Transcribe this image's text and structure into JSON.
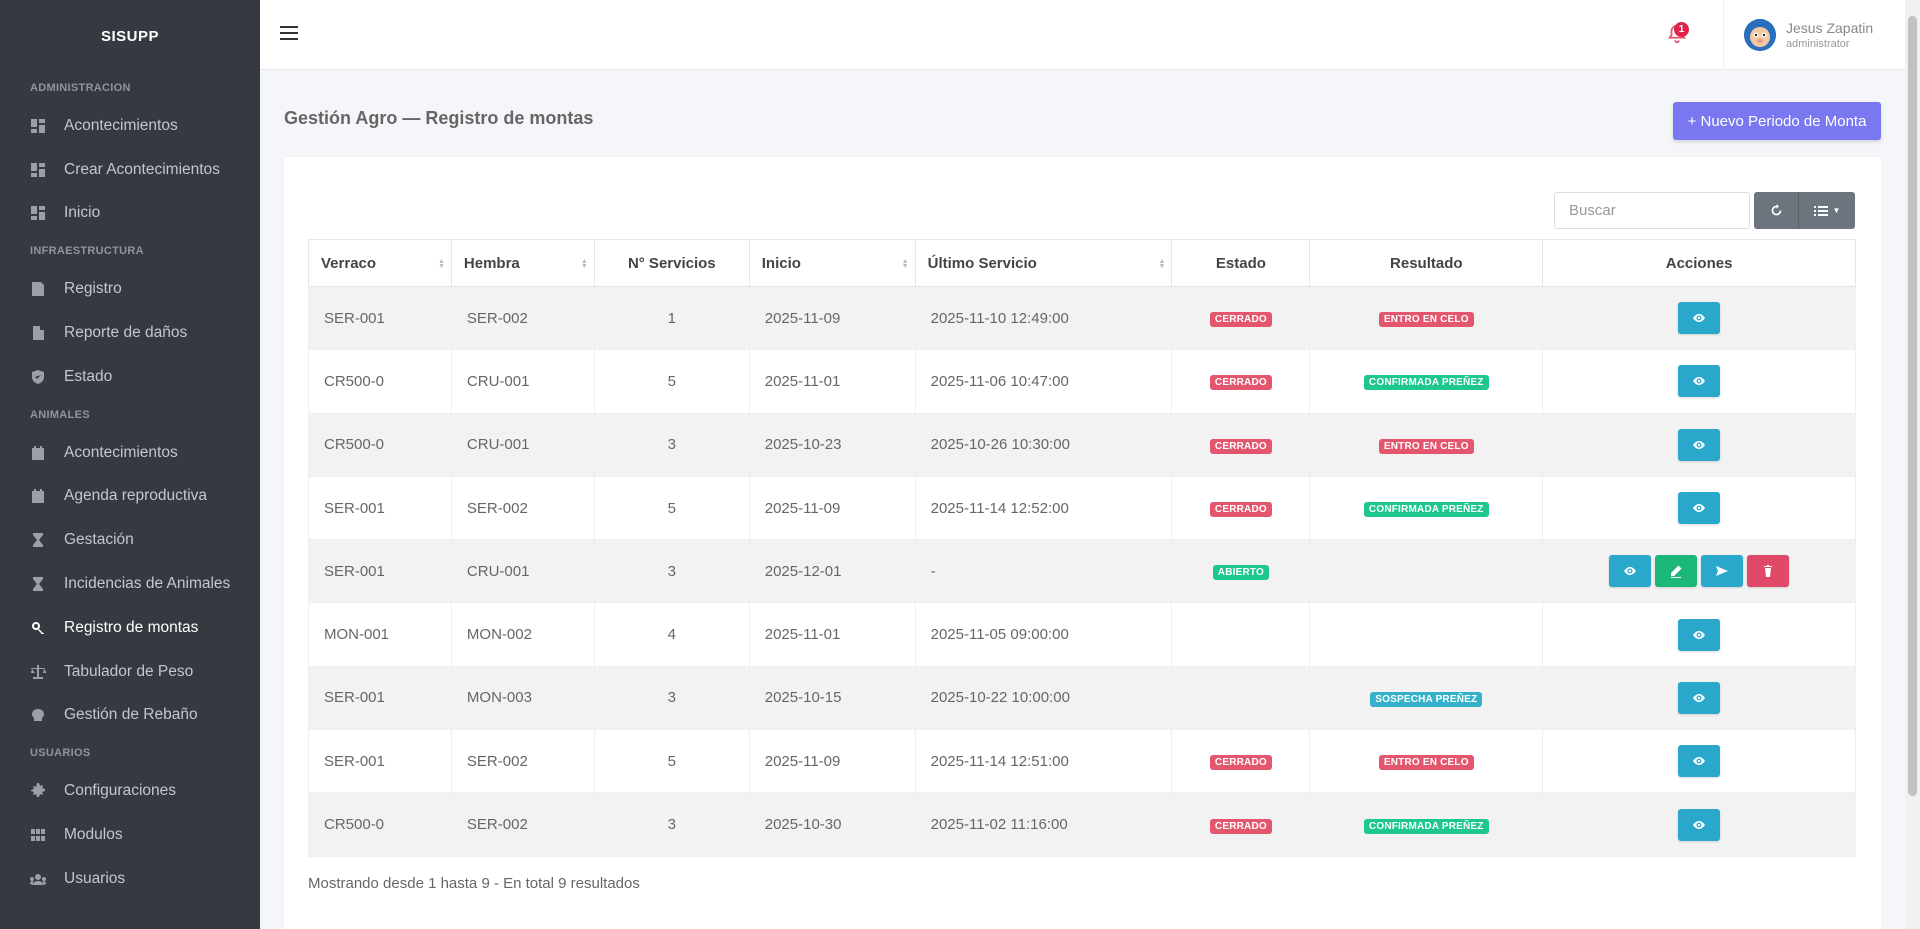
{
  "brand": "SISUPP",
  "sidebar": {
    "sections": [
      {
        "title": "ADMINISTRACION",
        "items": [
          {
            "label": "Acontecimientos",
            "icon": "dashboard-icon"
          },
          {
            "label": "Crear Acontecimientos",
            "icon": "dashboard-icon"
          },
          {
            "label": "Inicio",
            "icon": "dashboard-icon"
          }
        ]
      },
      {
        "title": "INFRAESTRUCTURA",
        "items": [
          {
            "label": "Registro",
            "icon": "report-icon"
          },
          {
            "label": "Reporte de daños",
            "icon": "file-icon"
          },
          {
            "label": "Estado",
            "icon": "shield-icon"
          }
        ]
      },
      {
        "title": "ANIMALES",
        "items": [
          {
            "label": "Acontecimientos",
            "icon": "calendar-icon"
          },
          {
            "label": "Agenda reproductiva",
            "icon": "calendar-icon"
          },
          {
            "label": "Gestación",
            "icon": "hourglass-icon"
          },
          {
            "label": "Incidencias de Animales",
            "icon": "hourglass-icon"
          },
          {
            "label": "Registro de montas",
            "icon": "gender-icon",
            "active": true
          },
          {
            "label": "Tabulador de Peso",
            "icon": "scale-icon"
          },
          {
            "label": "Gestión de Rebaño",
            "icon": "herd-icon"
          }
        ]
      },
      {
        "title": "USUARIOS",
        "items": [
          {
            "label": "Configuraciones",
            "icon": "gear-icon"
          },
          {
            "label": "Modulos",
            "icon": "grid-icon"
          },
          {
            "label": "Usuarios",
            "icon": "users-icon"
          }
        ]
      }
    ]
  },
  "header": {
    "notification_count": "1",
    "user_name": "Jesus Zapatin",
    "user_role": "administrator"
  },
  "page": {
    "title": "Gestión Agro — Registro de montas",
    "new_button": "+  Nuevo Periodo de Monta"
  },
  "table": {
    "search_placeholder": "Buscar",
    "columns": [
      "Verraco",
      "Hembra",
      "N° Servicios",
      "Inicio",
      "Último Servicio",
      "Estado",
      "Resultado",
      "Acciones"
    ],
    "rows": [
      {
        "verraco": "SER-001",
        "hembra": "SER-002",
        "servicios": "1",
        "inicio": "2025-11-09",
        "ultimo": "2025-11-10 12:49:00",
        "estado": "CERRADO",
        "resultado": "ENTRO EN CELO",
        "actions": "view"
      },
      {
        "verraco": "CR500-0",
        "hembra": "CRU-001",
        "servicios": "5",
        "inicio": "2025-11-01",
        "ultimo": "2025-11-06 10:47:00",
        "estado": "CERRADO",
        "resultado": "CONFIRMADA PREÑEZ",
        "actions": "view"
      },
      {
        "verraco": "CR500-0",
        "hembra": "CRU-001",
        "servicios": "3",
        "inicio": "2025-10-23",
        "ultimo": "2025-10-26 10:30:00",
        "estado": "CERRADO",
        "resultado": "ENTRO EN CELO",
        "actions": "view"
      },
      {
        "verraco": "SER-001",
        "hembra": "SER-002",
        "servicios": "5",
        "inicio": "2025-11-09",
        "ultimo": "2025-11-14 12:52:00",
        "estado": "CERRADO",
        "resultado": "CONFIRMADA PREÑEZ",
        "actions": "view"
      },
      {
        "verraco": "SER-001",
        "hembra": "CRU-001",
        "servicios": "3",
        "inicio": "2025-12-01",
        "ultimo": "-",
        "estado": "ABIERTO",
        "resultado": "",
        "actions": "all"
      },
      {
        "verraco": "MON-001",
        "hembra": "MON-002",
        "servicios": "4",
        "inicio": "2025-11-01",
        "ultimo": "2025-11-05 09:00:00",
        "estado": "",
        "resultado": "",
        "actions": "view"
      },
      {
        "verraco": "SER-001",
        "hembra": "MON-003",
        "servicios": "3",
        "inicio": "2025-10-15",
        "ultimo": "2025-10-22 10:00:00",
        "estado": "",
        "resultado": "SOSPECHA PREÑEZ",
        "actions": "view"
      },
      {
        "verraco": "SER-001",
        "hembra": "SER-002",
        "servicios": "5",
        "inicio": "2025-11-09",
        "ultimo": "2025-11-14 12:51:00",
        "estado": "CERRADO",
        "resultado": "ENTRO EN CELO",
        "actions": "view"
      },
      {
        "verraco": "CR500-0",
        "hembra": "SER-002",
        "servicios": "3",
        "inicio": "2025-10-30",
        "ultimo": "2025-11-02 11:16:00",
        "estado": "CERRADO",
        "resultado": "CONFIRMADA PREÑEZ",
        "actions": "view"
      }
    ],
    "footer": "Mostrando desde 1 hasta 9 - En total 9 resultados"
  }
}
